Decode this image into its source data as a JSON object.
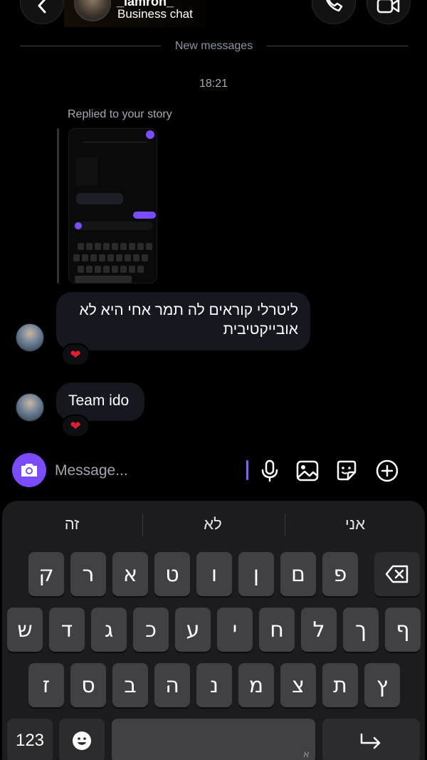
{
  "header": {
    "name": "_lamron_",
    "subtitle": "Business chat"
  },
  "divider": {
    "label": "New messages"
  },
  "timestamp": "18:21",
  "story_reply": {
    "label": "Replied to your story"
  },
  "messages": [
    {
      "text": "ליטרלי קוראים לה תמר אחי היא לא אובייקטיבית",
      "reaction": "❤"
    },
    {
      "text": "Team ido",
      "reaction": "❤"
    }
  ],
  "composer": {
    "placeholder": "Message..."
  },
  "keyboard": {
    "suggestions": [
      "זה",
      "לא",
      "אני"
    ],
    "row1": [
      "ק",
      "ר",
      "א",
      "ט",
      "ו",
      "ן",
      "ם",
      "פ"
    ],
    "row2": [
      "ש",
      "ד",
      "ג",
      "כ",
      "ע",
      "י",
      "ח",
      "ל",
      "ך",
      "ף"
    ],
    "row3": [
      "ז",
      "ס",
      "ב",
      "ה",
      "נ",
      "מ",
      "צ",
      "ת",
      "ץ"
    ],
    "numbers_key": "123",
    "space_hint": "א"
  },
  "colors": {
    "accent": "#7b4cff",
    "bubble": "#15191f",
    "keyboard_bg": "#1c1c1e",
    "key": "#414145"
  },
  "icons": [
    "back-icon",
    "phone-icon",
    "video-icon",
    "camera-icon",
    "mic-icon",
    "gallery-icon",
    "sticker-icon",
    "plus-icon",
    "backspace-icon",
    "emoji-icon",
    "return-icon"
  ]
}
